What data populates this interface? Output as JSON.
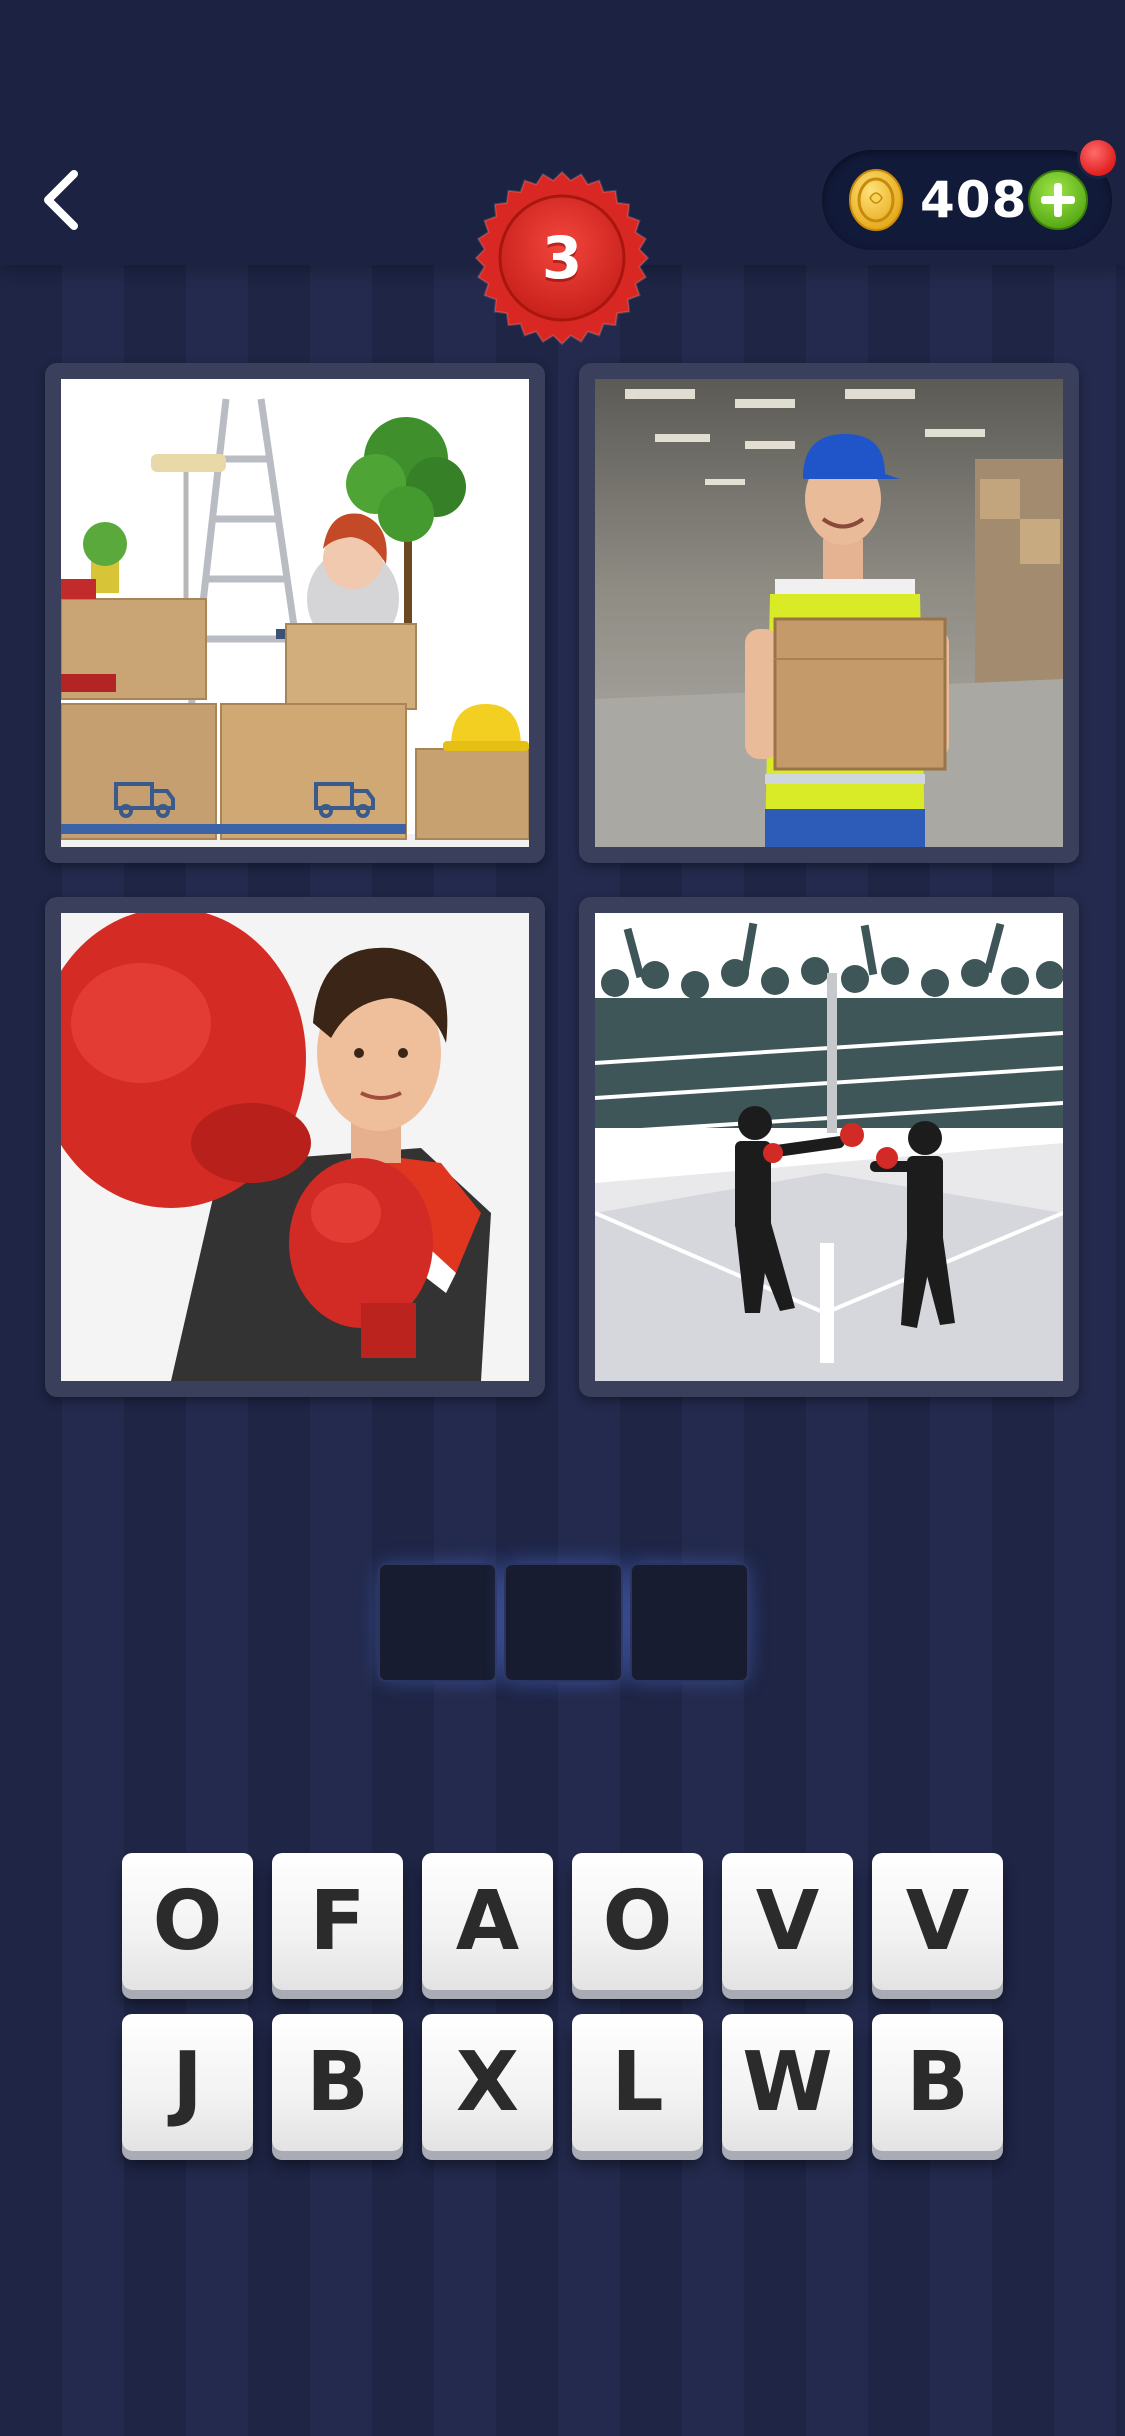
{
  "header": {
    "back_icon": "chevron-left-icon",
    "level": "3",
    "coins": "408",
    "coin_icon": "gold-coin-icon",
    "add_icon": "plus-icon",
    "notification": "red-dot"
  },
  "pictures": [
    {
      "subject": "woman among moving boxes with ladder and plant"
    },
    {
      "subject": "delivery man holding cardboard box in warehouse"
    },
    {
      "subject": "young man wearing red boxing gloves"
    },
    {
      "subject": "two businessmen boxing in a ring with crowd"
    }
  ],
  "answer": {
    "length": 3,
    "slots": [
      "",
      "",
      ""
    ]
  },
  "letters": {
    "row1": [
      "O",
      "F",
      "A",
      "O",
      "V",
      "V"
    ],
    "row2": [
      "J",
      "B",
      "X",
      "L",
      "W",
      "B"
    ]
  },
  "colors": {
    "background": "#1f2647",
    "header": "#1c2242",
    "badge_red": "#e3302a",
    "coin_gold": "#f7c530",
    "plus_green": "#6fc21f",
    "tile_white": "#f4f4f4",
    "slot_dark": "#171c30"
  }
}
